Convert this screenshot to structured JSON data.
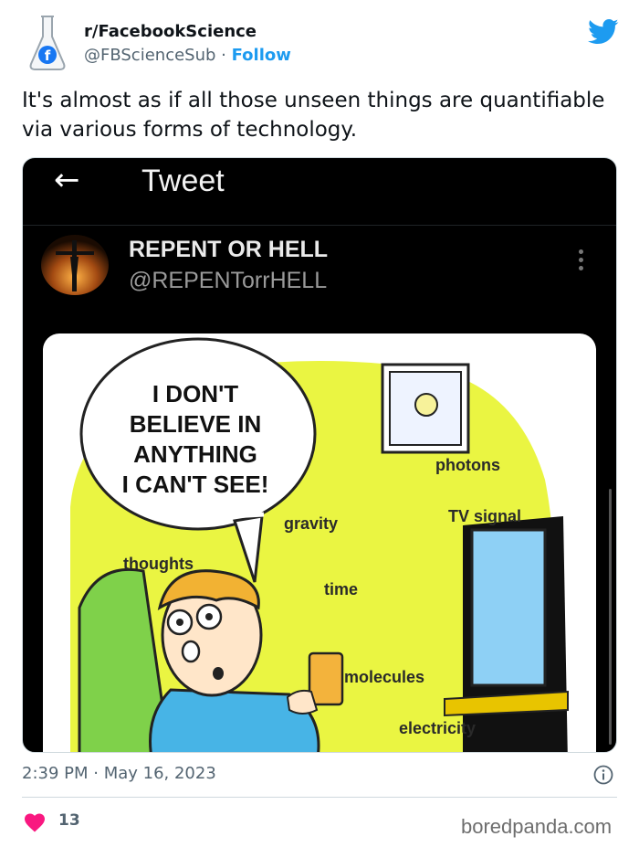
{
  "author": {
    "display_name": "r/FacebookScience",
    "handle": "@FBScienceSub",
    "separator": " · ",
    "follow_label": "Follow",
    "avatar_icon": "flask-facebook-icon"
  },
  "brand_icon": "twitter-bird-icon",
  "tweet": {
    "text": "It's almost as if all those unseen things are quantifiable via various forms of technology.",
    "timestamp": "2:39 PM · May 16, 2023",
    "like_count": "13"
  },
  "embedded": {
    "back_icon": "←",
    "title": "Tweet",
    "author_name": "REPENT OR HELL",
    "author_handle": "@REPENTorrHELL",
    "comic": {
      "speech": "I DON'T\nBELIEVE IN\nANYTHING\nI CAN'T SEE!",
      "labels": {
        "photons": "photons",
        "tv_signal": "TV signal",
        "gravity": "gravity",
        "thoughts": "thoughts",
        "time": "time",
        "molecules": "molecules",
        "electricity": "electricity"
      }
    }
  },
  "watermark": "boredpanda.com",
  "colors": {
    "accent": "#1d9bf0",
    "heart": "#f91880",
    "comic_wall": "#eaf542"
  }
}
